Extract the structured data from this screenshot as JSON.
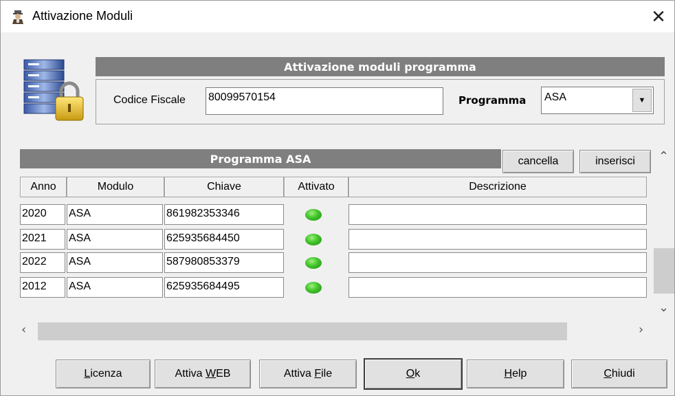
{
  "window": {
    "title": "Attivazione Moduli"
  },
  "header": {
    "title": "Attivazione moduli programma"
  },
  "fields": {
    "codice_fiscale_label": "Codice Fiscale",
    "codice_fiscale_value": "80099570154",
    "programma_label": "Programma",
    "programma_value": "ASA"
  },
  "section": {
    "title": "Programma ASA",
    "cancel_label": "cancella",
    "insert_label": "inserisci"
  },
  "table": {
    "columns": [
      "Anno",
      "Modulo",
      "Chiave",
      "Attivato",
      "Descrizione"
    ],
    "rows": [
      {
        "anno": "2020",
        "modulo": "ASA",
        "chiave": "861982353346",
        "attivato": true,
        "descrizione": ""
      },
      {
        "anno": "2021",
        "modulo": "ASA",
        "chiave": "625935684450",
        "attivato": true,
        "descrizione": ""
      },
      {
        "anno": "2022",
        "modulo": "ASA",
        "chiave": "587980853379",
        "attivato": true,
        "descrizione": ""
      },
      {
        "anno": "2012",
        "modulo": "ASA",
        "chiave": "625935684495",
        "attivato": true,
        "descrizione": ""
      }
    ]
  },
  "buttons": {
    "licenza": {
      "pre": "",
      "key": "L",
      "post": "icenza"
    },
    "attiva_web": {
      "pre": "Attiva ",
      "key": "W",
      "post": "EB"
    },
    "attiva_file": {
      "pre": "Attiva ",
      "key": "F",
      "post": "ile"
    },
    "ok": {
      "pre": "",
      "key": "O",
      "post": "k"
    },
    "help": {
      "pre": "",
      "key": "H",
      "post": "elp"
    },
    "chiudi": {
      "pre": "",
      "key": "C",
      "post": "hiudi"
    }
  },
  "icons": {
    "window_icon": "user-icon",
    "app_icon": "database-lock-icon",
    "close": "close-icon",
    "led": "green-led-icon"
  },
  "colors": {
    "bar_gray": "#7f7f7f",
    "led_green": "#41c22a"
  }
}
